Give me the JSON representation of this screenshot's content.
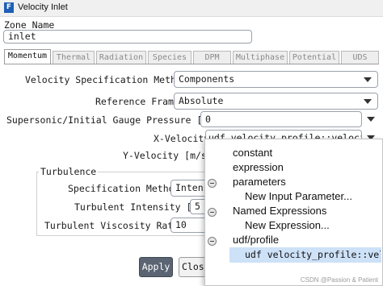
{
  "window": {
    "title": "Velocity Inlet",
    "app_icon_letter": "F"
  },
  "zone": {
    "label": "Zone Name",
    "value": "inlet"
  },
  "tabs": [
    {
      "label": "Momentum",
      "active": true
    },
    {
      "label": "Thermal",
      "active": false
    },
    {
      "label": "Radiation",
      "active": false
    },
    {
      "label": "Species",
      "active": false
    },
    {
      "label": "DPM",
      "active": false
    },
    {
      "label": "Multiphase",
      "active": false
    },
    {
      "label": "Potential",
      "active": false
    },
    {
      "label": "UDS",
      "active": false
    }
  ],
  "momentum": {
    "velocity_spec_label": "Velocity Specification Method",
    "velocity_spec_value": "Components",
    "reference_frame_label": "Reference Frame",
    "reference_frame_value": "Absolute",
    "gauge_pressure_label": "Supersonic/Initial Gauge Pressure [Pa]",
    "gauge_pressure_value": "0",
    "x_velocity_label": "X-Velocity",
    "x_velocity_value": "udf velocity_profile::velocity",
    "y_velocity_label": "Y-Velocity [m/s]"
  },
  "turbulence": {
    "title": "Turbulence",
    "spec_method_label": "Specification Method",
    "spec_method_value": "Intens",
    "intensity_label": "Turbulent Intensity [%]",
    "intensity_value": "5",
    "viscosity_ratio_label": "Turbulent Viscosity Ratio",
    "viscosity_ratio_value": "10"
  },
  "buttons": {
    "apply": "Apply",
    "close": "Close"
  },
  "dropdown": {
    "items": [
      {
        "label": "constant"
      },
      {
        "label": "expression"
      },
      {
        "label": "parameters"
      },
      {
        "label": "New Input Parameter..."
      },
      {
        "label": "Named Expressions"
      },
      {
        "label": "New Expression..."
      },
      {
        "label": "udf/profile"
      },
      {
        "label": "udf velocity_profile::velo"
      }
    ]
  },
  "watermark": "CSDN @Passion & Patient",
  "colors": {
    "accent": "#1f5fb5",
    "selection": "#cde1f7",
    "apply_button": "#5a6472"
  }
}
